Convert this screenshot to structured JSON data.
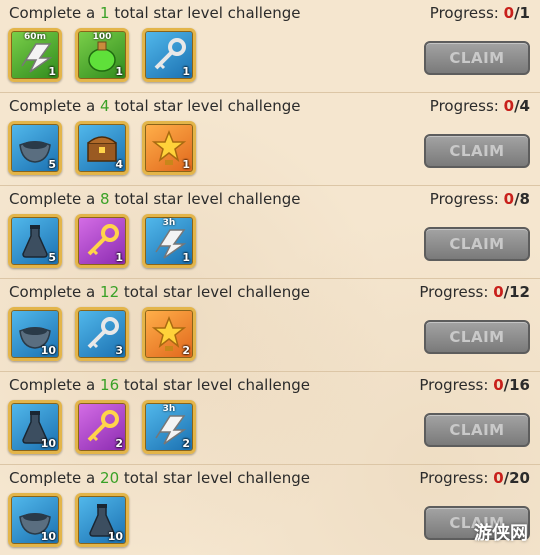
{
  "labels": {
    "prefix": "Complete a",
    "suffix": "total star level challenge",
    "progress": "Progress:",
    "claim": "CLAIM"
  },
  "challenges": [
    {
      "target": "1",
      "progress_current": "0",
      "progress_total": "/1",
      "rewards": [
        {
          "icon": "speedup-arrow-icon",
          "frame": "green",
          "tag": "60m",
          "qty": "1"
        },
        {
          "icon": "green-potion-icon",
          "frame": "green",
          "tag": "100",
          "qty": "1"
        },
        {
          "icon": "silver-key-icon",
          "frame": "blue",
          "tag": "",
          "qty": "1"
        }
      ]
    },
    {
      "target": "4",
      "progress_current": "0",
      "progress_total": "/4",
      "rewards": [
        {
          "icon": "bowl-icon",
          "frame": "blue",
          "tag": "",
          "qty": "5"
        },
        {
          "icon": "treasure-chest-icon",
          "frame": "blue",
          "tag": "",
          "qty": "4"
        },
        {
          "icon": "gold-star-trophy-icon",
          "frame": "orange",
          "tag": "",
          "qty": "1"
        }
      ]
    },
    {
      "target": "8",
      "progress_current": "0",
      "progress_total": "/8",
      "rewards": [
        {
          "icon": "flask-icon",
          "frame": "blue",
          "tag": "",
          "qty": "5"
        },
        {
          "icon": "gold-key-icon",
          "frame": "purple",
          "tag": "",
          "qty": "1"
        },
        {
          "icon": "speedup-arrow-icon",
          "frame": "blue",
          "tag": "3h",
          "qty": "1"
        }
      ]
    },
    {
      "target": "12",
      "progress_current": "0",
      "progress_total": "/12",
      "rewards": [
        {
          "icon": "bowl-icon",
          "frame": "blue",
          "tag": "",
          "qty": "10"
        },
        {
          "icon": "silver-key-icon",
          "frame": "blue",
          "tag": "",
          "qty": "3"
        },
        {
          "icon": "gold-star-trophy-icon",
          "frame": "orange",
          "tag": "",
          "qty": "2"
        }
      ]
    },
    {
      "target": "16",
      "progress_current": "0",
      "progress_total": "/16",
      "rewards": [
        {
          "icon": "flask-icon",
          "frame": "blue",
          "tag": "",
          "qty": "10"
        },
        {
          "icon": "gold-key-icon",
          "frame": "purple",
          "tag": "",
          "qty": "2"
        },
        {
          "icon": "speedup-arrow-icon",
          "frame": "blue",
          "tag": "3h",
          "qty": "2"
        }
      ]
    },
    {
      "target": "20",
      "progress_current": "0",
      "progress_total": "/20",
      "rewards": [
        {
          "icon": "bowl-icon",
          "frame": "blue",
          "tag": "",
          "qty": "10"
        },
        {
          "icon": "flask-icon",
          "frame": "blue",
          "tag": "",
          "qty": "10"
        }
      ]
    }
  ],
  "watermark": "游侠网"
}
